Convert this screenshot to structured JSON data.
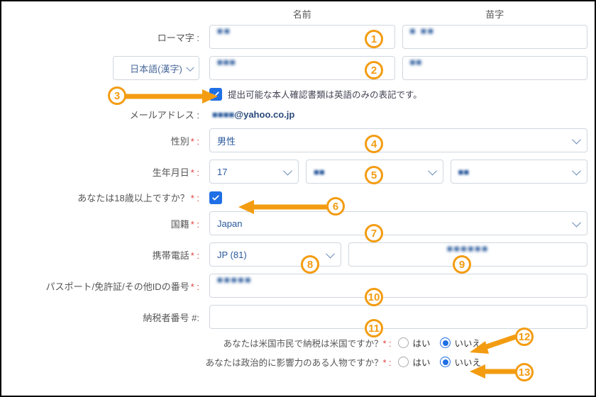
{
  "headers": {
    "first": "名前",
    "last": "苗字"
  },
  "labels": {
    "romaji": "ローマ字 :",
    "kanji": "日本語(漢字)",
    "idDocNote": "提出可能な本人確認書類は英語のみの表記です。",
    "email": "メールアドレス :",
    "gender": "性別",
    "dob": "生年月日",
    "over18": "あなたは18歳以上ですか？",
    "nationality": "国籍",
    "phone": "携帯電話",
    "passport": "パスポート/免許証/その他IDの番号",
    "taxid": "納税者番号 #:",
    "usCitizen": "あなたは米国市民で納税は米国ですか？",
    "pep": "あなたは政治的に影響力のある人物ですか？"
  },
  "values": {
    "romajiFirst": "■■",
    "romajiLast": "■ ■■",
    "kanjiFirst": "■■■",
    "kanjiLast": "■■",
    "emailLocal": "■■■■",
    "emailDomain": "@yahoo.co.jp",
    "gender": "男性",
    "dobDay": "17",
    "dobMonth": "■■",
    "dobYear": "■■",
    "nationality": "Japan",
    "phoneCountry": "JP (81)",
    "phoneNumber": "■■■■■■",
    "passport": "■■■■■"
  },
  "radios": {
    "yes": "はい",
    "no": "いいえ"
  },
  "badges": [
    "1",
    "2",
    "3",
    "4",
    "5",
    "6",
    "7",
    "8",
    "9",
    "10",
    "11",
    "12",
    "13"
  ]
}
